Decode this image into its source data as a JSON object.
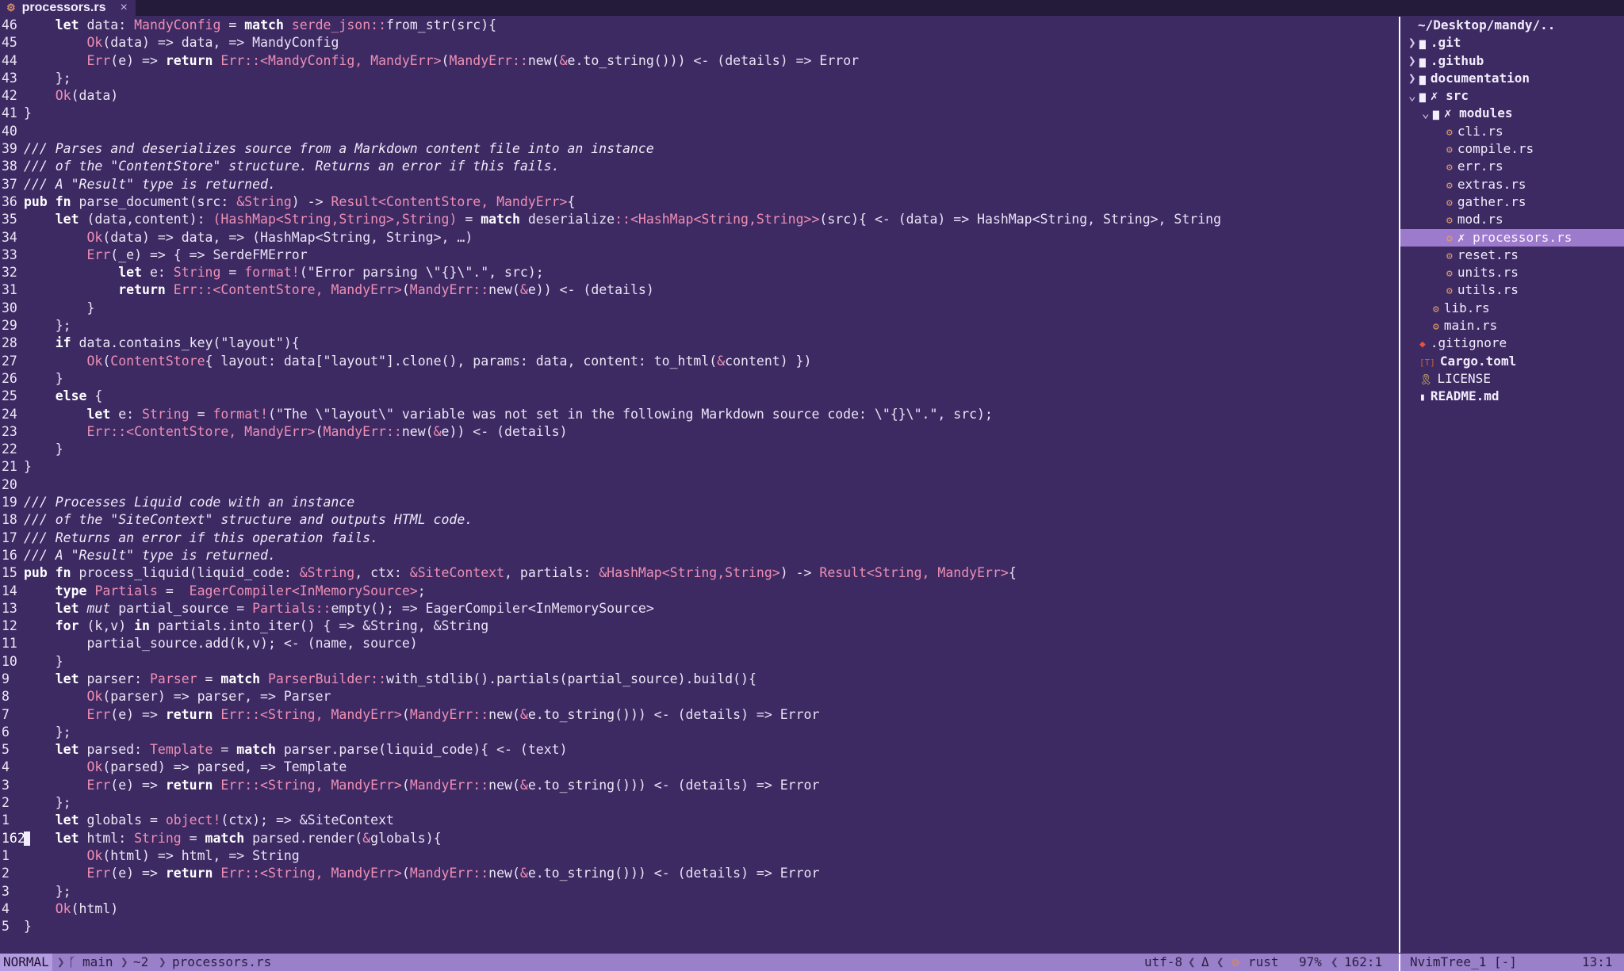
{
  "tab": {
    "label": "processors.rs",
    "icon": "rust-file-icon",
    "close": "×"
  },
  "editor": {
    "lines": [
      {
        "n": "46",
        "html": "    <span class='kw'>let</span> data: <span class='ty'>MandyConfig</span> = <span class='kw'>match</span> <span class='ty'>serde_json::</span>from_str(src){"
      },
      {
        "n": "45",
        "html": "        <span class='ty'>Ok</span>(data) =&gt; data, <span class='hint'>=&gt; MandyConfig</span>"
      },
      {
        "n": "44",
        "html": "        <span class='ty'>Err</span>(e) =&gt; <span class='kw'>return</span> <span class='ty'>Err::&lt;MandyConfig, MandyErr&gt;</span>(<span class='ty'>MandyErr::</span>new(<span class='ty'>&amp;</span>e.to_string())) <span class='hint'>&lt;- (details) =&gt; Error</span>"
      },
      {
        "n": "43",
        "html": "    };"
      },
      {
        "n": "42",
        "html": "    <span class='ty'>Ok</span>(data)"
      },
      {
        "n": "41",
        "html": "}"
      },
      {
        "n": "40",
        "html": ""
      },
      {
        "n": "39",
        "html": "<span class='cm'>/// Parses and deserializes source from a Markdown content file into an instance</span>"
      },
      {
        "n": "38",
        "html": "<span class='cm'>/// of the \"ContentStore\" structure. Returns an error if this fails.</span>"
      },
      {
        "n": "37",
        "html": "<span class='cm'>/// A \"Result\" type is returned.</span>"
      },
      {
        "n": "36",
        "html": "<span class='kw'>pub fn</span> parse_document(src: <span class='ty'>&amp;String</span>) -&gt; <span class='ty'>Result&lt;ContentStore, MandyErr&gt;</span>{"
      },
      {
        "n": "35",
        "html": "    <span class='kw'>let</span> (data,content): <span class='ty'>(HashMap&lt;String,String&gt;,String)</span> = <span class='kw'>match</span> deserialize<span class='ty'>::&lt;HashMap&lt;String,String&gt;&gt;</span>(src){ <span class='hint'>&lt;- (data) =&gt; HashMap&lt;String, String&gt;, String</span>"
      },
      {
        "n": "34",
        "html": "        <span class='ty'>Ok</span>(data) =&gt; data, <span class='hint'>=&gt; (HashMap&lt;String, String&gt;, …)</span>"
      },
      {
        "n": "33",
        "html": "        <span class='ty'>Err</span>(_e) =&gt; { <span class='hint'>=&gt; SerdeFMError</span>"
      },
      {
        "n": "32",
        "html": "            <span class='kw'>let</span> e: <span class='ty'>String</span> = <span class='ty'>format!</span>(\"Error parsing \\\"{}\\\".\", src);"
      },
      {
        "n": "31",
        "html": "            <span class='kw'>return</span> <span class='ty'>Err::&lt;ContentStore, MandyErr&gt;</span>(<span class='ty'>MandyErr::</span>new(<span class='ty'>&amp;</span>e)) <span class='hint'>&lt;- (details)</span>"
      },
      {
        "n": "30",
        "html": "        }"
      },
      {
        "n": "29",
        "html": "    };"
      },
      {
        "n": "28",
        "html": "    <span class='kw'>if</span> data.contains_key(\"layout\"){"
      },
      {
        "n": "27",
        "html": "        <span class='ty'>Ok</span>(<span class='ty'>ContentStore</span>{ layout: data[\"layout\"].clone(), params: data, content: to_html(<span class='ty'>&amp;</span>content) })"
      },
      {
        "n": "26",
        "html": "    }"
      },
      {
        "n": "25",
        "html": "    <span class='kw'>else</span> {"
      },
      {
        "n": "24",
        "html": "        <span class='kw'>let</span> e: <span class='ty'>String</span> = <span class='ty'>format!</span>(\"The \\\"layout\\\" variable was not set in the following Markdown source code: \\\"{}\\\".\", src);"
      },
      {
        "n": "23",
        "html": "        <span class='ty'>Err::&lt;ContentStore, MandyErr&gt;</span>(<span class='ty'>MandyErr::</span>new(<span class='ty'>&amp;</span>e)) <span class='hint'>&lt;- (details)</span>"
      },
      {
        "n": "22",
        "html": "    }"
      },
      {
        "n": "21",
        "html": "}"
      },
      {
        "n": "20",
        "html": ""
      },
      {
        "n": "19",
        "html": "<span class='cm'>/// Processes Liquid code with an instance</span>"
      },
      {
        "n": "18",
        "html": "<span class='cm'>/// of the \"SiteContext\" structure and outputs HTML code.</span>"
      },
      {
        "n": "17",
        "html": "<span class='cm'>/// Returns an error if this operation fails.</span>"
      },
      {
        "n": "16",
        "html": "<span class='cm'>/// A \"Result\" type is returned.</span>"
      },
      {
        "n": "15",
        "html": "<span class='kw'>pub fn</span> process_liquid(liquid_code: <span class='ty'>&amp;String</span>, ctx: <span class='ty'>&amp;SiteContext</span>, partials: <span class='ty'>&amp;HashMap&lt;String,String&gt;</span>) -&gt; <span class='ty'>Result&lt;String, MandyErr&gt;</span>{"
      },
      {
        "n": "14",
        "html": "    <span class='kw'>type</span> <span class='ty'>Partials</span> =  <span class='ty'>EagerCompiler&lt;InMemorySource&gt;</span>;"
      },
      {
        "n": "13",
        "html": "    <span class='kw'>let</span> <span class='mu'>mut</span> partial_source = <span class='ty'>Partials::</span>empty(); <span class='hint'>=&gt; EagerCompiler&lt;InMemorySource&gt;</span>"
      },
      {
        "n": "12",
        "html": "    <span class='kw'>for</span> (k,v) <span class='kw'>in</span> partials.into_iter() { <span class='hint'>=&gt; &amp;String, &amp;String</span>"
      },
      {
        "n": "11",
        "html": "        partial_source.add(k,v); <span class='hint'>&lt;- (name, source)</span>"
      },
      {
        "n": "10",
        "html": "    }"
      },
      {
        "n": "9",
        "html": "    <span class='kw'>let</span> parser: <span class='ty'>Parser</span> = <span class='kw'>match</span> <span class='ty'>ParserBuilder::</span>with_stdlib().partials(partial_source).build(){"
      },
      {
        "n": "8",
        "html": "        <span class='ty'>Ok</span>(parser) =&gt; parser, <span class='hint'>=&gt; Parser</span>"
      },
      {
        "n": "7",
        "html": "        <span class='ty'>Err</span>(e) =&gt; <span class='kw'>return</span> <span class='ty'>Err::&lt;String, MandyErr&gt;</span>(<span class='ty'>MandyErr::</span>new(<span class='ty'>&amp;</span>e.to_string())) <span class='hint'>&lt;- (details) =&gt; Error</span>"
      },
      {
        "n": "6",
        "html": "    };"
      },
      {
        "n": "5",
        "html": "    <span class='kw'>let</span> parsed: <span class='ty'>Template</span> = <span class='kw'>match</span> parser.parse(liquid_code){ <span class='hint'>&lt;- (text)</span>"
      },
      {
        "n": "4",
        "html": "        <span class='ty'>Ok</span>(parsed) =&gt; parsed, <span class='hint'>=&gt; Template</span>"
      },
      {
        "n": "3",
        "html": "        <span class='ty'>Err</span>(e) =&gt; <span class='kw'>return</span> <span class='ty'>Err::&lt;String, MandyErr&gt;</span>(<span class='ty'>MandyErr::</span>new(<span class='ty'>&amp;</span>e.to_string())) <span class='hint'>&lt;- (details) =&gt; Error</span>"
      },
      {
        "n": "2",
        "html": "    };"
      },
      {
        "n": "1",
        "html": "    <span class='kw'>let</span> globals = <span class='ty'>object!</span>(ctx); <span class='hint'>=&gt; &amp;SiteContext</span>"
      },
      {
        "n": "162",
        "cur": true,
        "html": "    <span class='kw'>let</span> html: <span class='ty'>String</span> = <span class='kw'>match</span> parsed.render(<span class='ty'>&amp;</span>globals){"
      },
      {
        "n": "1",
        "html": "        <span class='ty'>Ok</span>(html) =&gt; html, <span class='hint'>=&gt; String</span>"
      },
      {
        "n": "2",
        "html": "        <span class='ty'>Err</span>(e) =&gt; <span class='kw'>return</span> <span class='ty'>Err::&lt;String, MandyErr&gt;</span>(<span class='ty'>MandyErr::</span>new(<span class='ty'>&amp;</span>e.to_string())) <span class='hint'>&lt;- (details) =&gt; Error</span>"
      },
      {
        "n": "3",
        "html": "    };"
      },
      {
        "n": "4",
        "html": "    <span class='ty'>Ok</span>(html)"
      },
      {
        "n": "5",
        "html": "}"
      }
    ]
  },
  "tree": {
    "root": "~/Desktop/mandy/..",
    "items": [
      {
        "indent": 0,
        "arrow": "❯",
        "icon": "▆",
        "iconClass": "folder",
        "label": ".git",
        "bold": true
      },
      {
        "indent": 0,
        "arrow": "❯",
        "icon": "▆",
        "iconClass": "folder",
        "label": ".github",
        "bold": true
      },
      {
        "indent": 0,
        "arrow": "❯",
        "icon": "▆",
        "iconClass": "folder",
        "label": "documentation",
        "bold": true
      },
      {
        "indent": 0,
        "arrow": "⌄",
        "icon": "▆",
        "iconClass": "folder",
        "label": "✗ src",
        "bold": true
      },
      {
        "indent": 1,
        "arrow": "⌄",
        "icon": "▆",
        "iconClass": "folder",
        "label": "✗ modules",
        "bold": true
      },
      {
        "indent": 2,
        "arrow": "",
        "icon": "⚙",
        "iconClass": "rsicon",
        "label": "cli.rs"
      },
      {
        "indent": 2,
        "arrow": "",
        "icon": "⚙",
        "iconClass": "rsicon",
        "label": "compile.rs"
      },
      {
        "indent": 2,
        "arrow": "",
        "icon": "⚙",
        "iconClass": "rsicon",
        "label": "err.rs"
      },
      {
        "indent": 2,
        "arrow": "",
        "icon": "⚙",
        "iconClass": "rsicon",
        "label": "extras.rs"
      },
      {
        "indent": 2,
        "arrow": "",
        "icon": "⚙",
        "iconClass": "rsicon",
        "label": "gather.rs"
      },
      {
        "indent": 2,
        "arrow": "",
        "icon": "⚙",
        "iconClass": "rsicon",
        "label": "mod.rs"
      },
      {
        "indent": 2,
        "arrow": "",
        "icon": "⚙",
        "iconClass": "rsicon",
        "label": "✗ processors.rs",
        "selected": true
      },
      {
        "indent": 2,
        "arrow": "",
        "icon": "⚙",
        "iconClass": "rsicon",
        "label": "reset.rs"
      },
      {
        "indent": 2,
        "arrow": "",
        "icon": "⚙",
        "iconClass": "rsicon",
        "label": "units.rs"
      },
      {
        "indent": 2,
        "arrow": "",
        "icon": "⚙",
        "iconClass": "rsicon",
        "label": "utils.rs"
      },
      {
        "indent": 1,
        "arrow": "",
        "icon": "⚙",
        "iconClass": "rsicon",
        "label": "lib.rs"
      },
      {
        "indent": 1,
        "arrow": "",
        "icon": "⚙",
        "iconClass": "rsicon",
        "label": "main.rs"
      },
      {
        "indent": 0,
        "arrow": "",
        "icon": "◆",
        "iconClass": "gitic",
        "label": ".gitignore"
      },
      {
        "indent": 0,
        "arrow": "",
        "icon": "[T]",
        "iconClass": "tomlic",
        "label": "Cargo.toml",
        "bold": true
      },
      {
        "indent": 0,
        "arrow": "",
        "icon": "🎗",
        "iconClass": "licic",
        "label": "LICENSE"
      },
      {
        "indent": 0,
        "arrow": "",
        "icon": "▮",
        "iconClass": "folder",
        "label": "README.md",
        "bold": true
      }
    ]
  },
  "status": {
    "mode": "NORMAL",
    "branch_icon": "",
    "branch": "main",
    "changes": "~2",
    "filename": "processors.rs",
    "encoding": "utf-8",
    "delta": "Δ",
    "filetype_icon": "⚙",
    "filetype": "rust",
    "percent": "97%",
    "position": "162:1",
    "tree_name": "NvimTree_1 [-]",
    "tree_position": "13:1"
  }
}
